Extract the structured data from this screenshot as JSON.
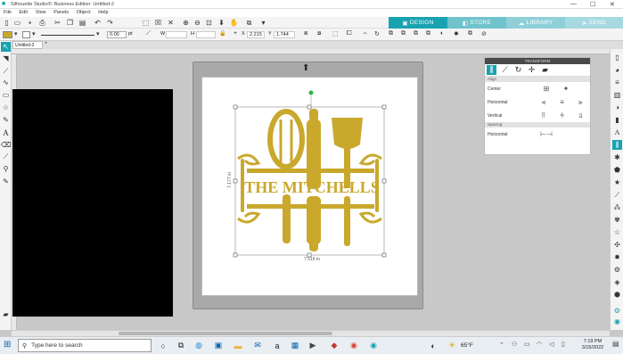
{
  "window": {
    "title": "Silhouette Studio®: Business Edition: Untitled-2"
  },
  "menu": [
    "File",
    "Edit",
    "View",
    "Panels",
    "Object",
    "Help"
  ],
  "tabs": [
    {
      "label": "DESIGN",
      "color": "#19a3b1"
    },
    {
      "label": "STORE",
      "color": "#6fc3cc"
    },
    {
      "label": "LIBRARY",
      "color": "#8fd0d8"
    },
    {
      "label": "SEND",
      "color": "#a6dae0"
    }
  ],
  "options": {
    "line_width": "0.00",
    "unit": "pt",
    "w_label": "W",
    "h_label": "H",
    "x_value": "2.215",
    "y_value": "1.744",
    "x_label": "X",
    "y_label": "Y"
  },
  "doc_tab": "Untitled-2",
  "design": {
    "text": "THE MITCHELLS",
    "width_label": "7.516 in",
    "height_label": "7.177 in",
    "gold": "#c9a82c"
  },
  "transform": {
    "header": "TRANSFORM",
    "align_section": "Align",
    "rows": {
      "center": "Center",
      "horizontal": "Horizontal",
      "vertical": "Vertical"
    },
    "spacing_section": "Spacing",
    "spacing_row": "Horizontal"
  },
  "taskbar": {
    "search_placeholder": "Type here to search",
    "weather": "65°F",
    "time": "7:19 PM",
    "date": "3/15/2022"
  }
}
